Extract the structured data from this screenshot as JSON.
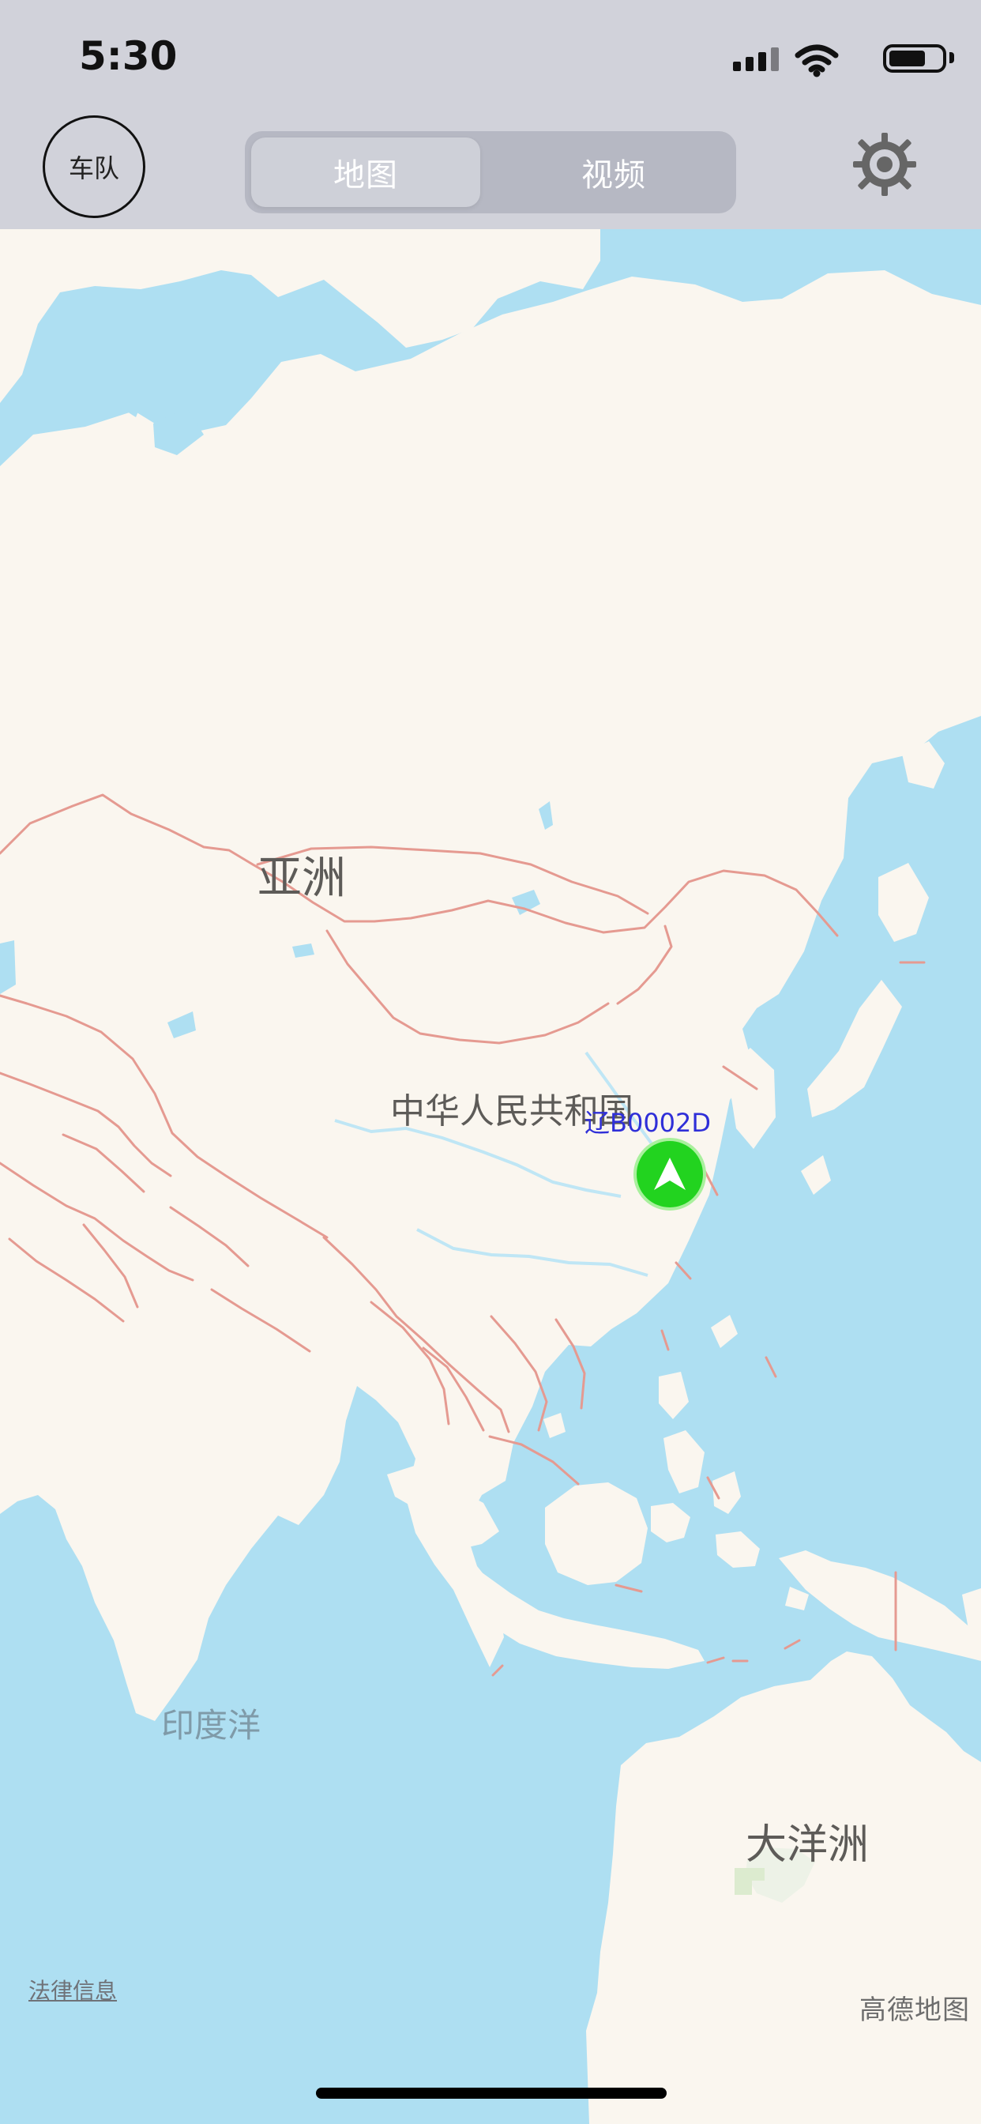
{
  "status_bar": {
    "time": "5:30",
    "battery_level": 0.7,
    "icons": [
      "signal-icon",
      "wifi-icon",
      "battery-icon"
    ]
  },
  "header": {
    "team_button_label": "车队",
    "tabs": [
      {
        "label": "地图",
        "active": true
      },
      {
        "label": "视频",
        "active": false
      }
    ],
    "settings_icon": "gear-icon"
  },
  "map": {
    "labels": {
      "asia": "亚洲",
      "china": "中华人民共和国",
      "indian_ocean": "印度洋",
      "oceania": "大洋洲"
    },
    "vehicle": {
      "plate": "辽B0002D",
      "marker_icon": "navigation-arrow-icon",
      "marker_color": "#22d31f"
    },
    "legal_link": "法律信息",
    "logo_text": "高德地图"
  },
  "colors": {
    "water": "#aedff2",
    "land": "#faf6ef",
    "border": "#e59a91",
    "header_bg": "#d1d2da"
  }
}
